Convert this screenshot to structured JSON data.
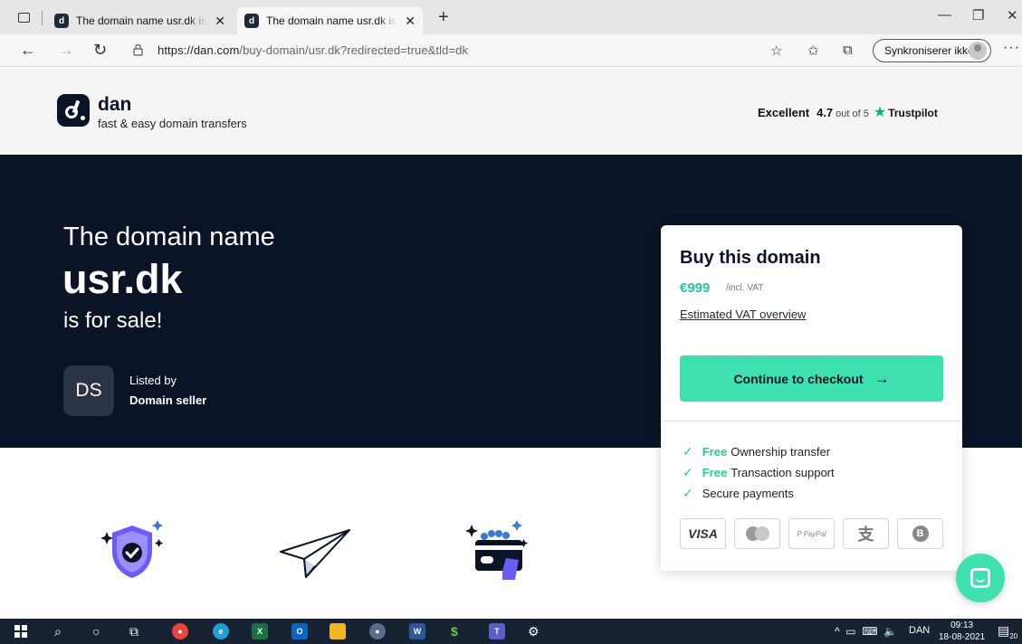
{
  "browser": {
    "tabs": [
      {
        "title": "The domain name usr.dk is for sale",
        "favicon": "dan-logo-icon"
      },
      {
        "title": "The domain name usr.dk is for sale",
        "favicon": "dan-logo-icon"
      }
    ],
    "url_host": "https://dan.com",
    "url_path": "/buy-domain/usr.dk?redirected=true&tld=dk",
    "sync_label": "Synkroniserer ikke"
  },
  "header": {
    "logo_name": "dan",
    "logo_tagline": "fast & easy domain transfers",
    "trust_excellent": "Excellent",
    "trust_score": "4.7",
    "trust_outof": "out of 5",
    "trust_brand": "Trustpilot"
  },
  "hero": {
    "line1": "The domain name",
    "domain": "usr.dk",
    "line3": "is for sale!",
    "seller_initials": "DS",
    "listed_by": "Listed by",
    "seller_name": "Domain seller"
  },
  "buy_card": {
    "title": "Buy this domain",
    "price": "€999",
    "price_note": "/incl. VAT",
    "vat_link": "Estimated VAT overview",
    "checkout_label": "Continue to checkout",
    "features": [
      {
        "free": "Free",
        "text": "Ownership transfer"
      },
      {
        "free": "Free",
        "text": "Transaction support"
      },
      {
        "free": "",
        "text": "Secure payments"
      }
    ],
    "payment_methods": {
      "visa": "VISA",
      "paypal": "P PayPal",
      "alipay": "支",
      "bitcoin": "B"
    }
  },
  "taskbar": {
    "lang": "DAN",
    "time": "09:13",
    "date": "18-08-2021",
    "notif_count": "20"
  },
  "colors": {
    "brand_navy": "#0b1327",
    "accent_green": "#3ee0b0",
    "price_green": "#27c79a",
    "trustpilot_green": "#00b67a"
  }
}
